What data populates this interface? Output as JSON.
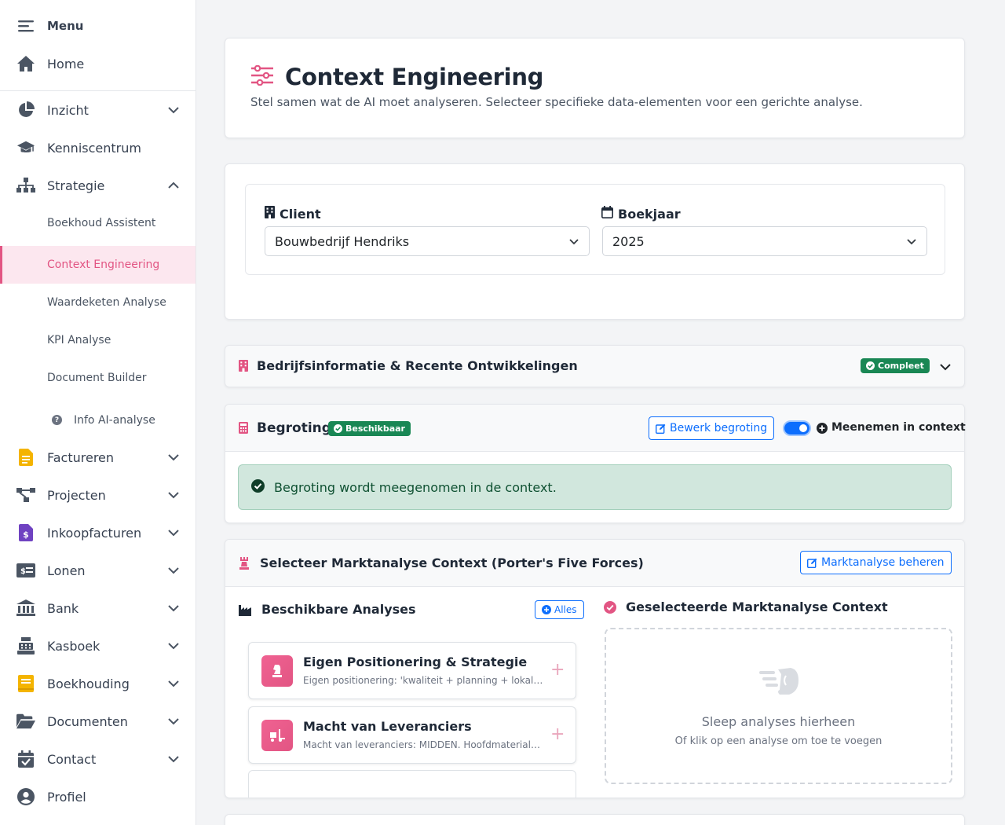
{
  "sidebar": {
    "menu_label": "Menu",
    "home": "Home",
    "inzicht": "Inzicht",
    "kenniscentrum": "Kenniscentrum",
    "strategie": "Strategie",
    "sub": {
      "boekhoud_assistent": "Boekhoud Assistent",
      "context_engineering": "Context Engineering",
      "waardeketen": "Waardeketen Analyse",
      "kpi": "KPI Analyse",
      "document_builder": "Document Builder",
      "info_ai": "Info AI-analyse"
    },
    "factureren": "Factureren",
    "projecten": "Projecten",
    "inkoopfacturen": "Inkoopfacturen",
    "lonen": "Lonen",
    "bank": "Bank",
    "kasboek": "Kasboek",
    "boekhouding": "Boekhouding",
    "documenten": "Documenten",
    "contact": "Contact",
    "profiel": "Profiel"
  },
  "header": {
    "title": "Context Engineering",
    "subtitle": "Stel samen wat de AI moet analyseren. Selecteer specifieke data-elementen voor een gerichte analyse."
  },
  "filters": {
    "client_label": "Client",
    "client_value": "Bouwbedrijf Hendriks",
    "year_label": "Boekjaar",
    "year_value": "2025"
  },
  "bedrijfsinfo": {
    "title": "Bedrijfsinformatie & Recente Ontwikkelingen",
    "badge": "Compleet"
  },
  "begroting": {
    "title": "Begroting",
    "badge": "Beschikbaar",
    "edit_button": "Bewerk begroting",
    "include_label": "Meenemen in context",
    "include_enabled": true,
    "alert": "Begroting wordt meegenomen in de context."
  },
  "markt": {
    "title": "Selecteer Marktanalyse Context (Porter's Five Forces)",
    "manage_button": "Marktanalyse beheren",
    "available_title": "Beschikbare Analyses",
    "all_button": "Alles",
    "selected_title": "Geselecteerde Marktanalyse Context",
    "analyses": [
      {
        "title": "Eigen Positionering & Strategie",
        "desc": "Eigen positionering: 'kwaliteit + planning + lokale aanwezigheid'"
      },
      {
        "title": "Macht van Leveranciers",
        "desc": "Macht van leveranciers: MIDDEN. Hoofdmaterialen en onderaannemers"
      }
    ],
    "dropzone_title": "Sleep analyses hierheen",
    "dropzone_sub": "Of klik op een analyse om toe te voegen"
  },
  "colors": {
    "accent": "#e25583",
    "primary": "#0d6efd",
    "success": "#198754"
  }
}
